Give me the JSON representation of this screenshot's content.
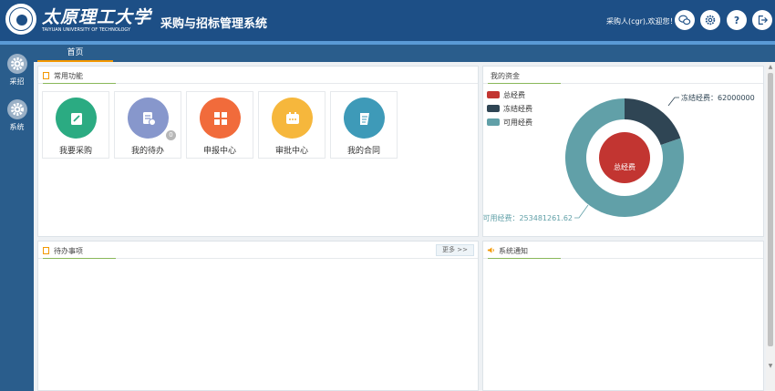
{
  "header": {
    "logo_cn": "太原理工大学",
    "logo_en": "TAIYUAN UNIVERSITY OF TECHNOLOGY",
    "app_title": "采购与招标管理系统",
    "welcome": "采购人(cgr),欢迎您！",
    "buttons": [
      {
        "name": "wechat-icon"
      },
      {
        "name": "settings-icon"
      },
      {
        "name": "help-icon"
      },
      {
        "name": "logout-icon"
      }
    ],
    "colors": {
      "bar": "#1d4f86",
      "strip": "#5a9ad6"
    }
  },
  "sidebar": {
    "items": [
      {
        "label": "采招",
        "icon": "gear-icon"
      },
      {
        "label": "系统",
        "icon": "gear-icon"
      }
    ]
  },
  "tabs": {
    "home": "首页"
  },
  "functions": {
    "title": "常用功能",
    "items": [
      {
        "label": "我要采购",
        "icon": "edit-icon",
        "color": "#2bab82"
      },
      {
        "label": "我的待办",
        "icon": "todo-icon",
        "color": "#8797cc",
        "badge": "0"
      },
      {
        "label": "申报中心",
        "icon": "grid-icon",
        "color": "#f16b3b"
      },
      {
        "label": "审批中心",
        "icon": "approval-icon",
        "color": "#f6b73c"
      },
      {
        "label": "我的合同",
        "icon": "contract-icon",
        "color": "#3e9ab8"
      }
    ]
  },
  "funds": {
    "title": "我的资金",
    "legend": [
      {
        "label": "总经费",
        "color": "#c23531"
      },
      {
        "label": "冻结经费",
        "color": "#2f4554"
      },
      {
        "label": "可用经费",
        "color": "#61a0a8"
      }
    ],
    "center_label": "总经费",
    "frozen_label": "冻结经费：62000000",
    "available_label": "可用经费：253481261.62"
  },
  "chart_data": {
    "type": "pie",
    "series": [
      {
        "name": "总经费",
        "values": [
          315481261.62
        ]
      },
      {
        "name": "冻结经费",
        "values": [
          62000000
        ]
      },
      {
        "name": "可用经费",
        "values": [
          253481261.62
        ]
      }
    ],
    "legend_position": "top-left"
  },
  "todo": {
    "title": "待办事项",
    "more": "更多 >>"
  },
  "notice": {
    "title": "系统通知"
  }
}
